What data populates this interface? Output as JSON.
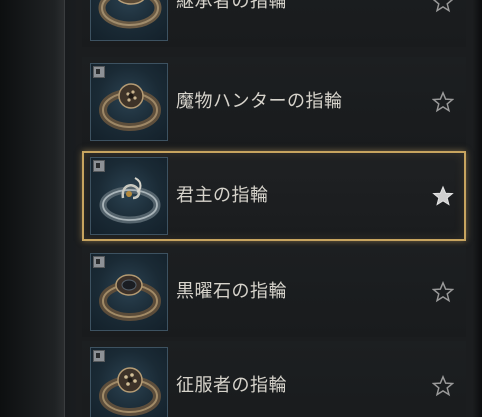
{
  "rings": [
    {
      "name": "継承者の指輪",
      "favorite": false,
      "selected": false
    },
    {
      "name": "魔物ハンターの指輪",
      "favorite": false,
      "selected": false
    },
    {
      "name": "君主の指輪",
      "favorite": true,
      "selected": true
    },
    {
      "name": "黒曜石の指輪",
      "favorite": false,
      "selected": false
    },
    {
      "name": "征服者の指輪",
      "favorite": false,
      "selected": false
    }
  ],
  "colors": {
    "selection_border": "#c7a45f",
    "star_outline": "#9a9a9a",
    "star_filled": "#cfcfcf"
  }
}
